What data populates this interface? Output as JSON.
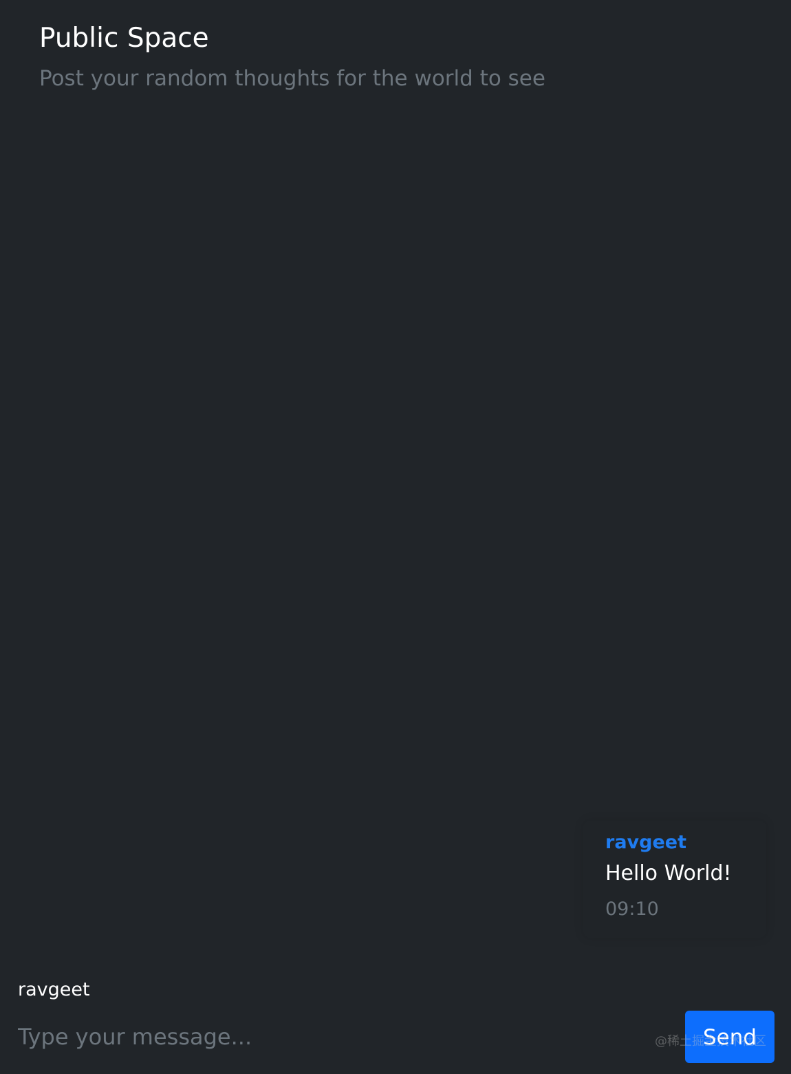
{
  "header": {
    "title": "Public Space",
    "subtitle": "Post your random thoughts for the world to see"
  },
  "messages": [
    {
      "author": "ravgeet",
      "text": "Hello World!",
      "time": "09:10"
    }
  ],
  "composer": {
    "username": "ravgeet",
    "placeholder": "Type your message...",
    "value": "",
    "send_label": "Send"
  },
  "watermark": {
    "text": "@稀土掘金技术社区"
  },
  "colors": {
    "background": "#212529",
    "accent": "#0d6efd",
    "author": "#1f7cf0",
    "muted": "#6c757d"
  }
}
